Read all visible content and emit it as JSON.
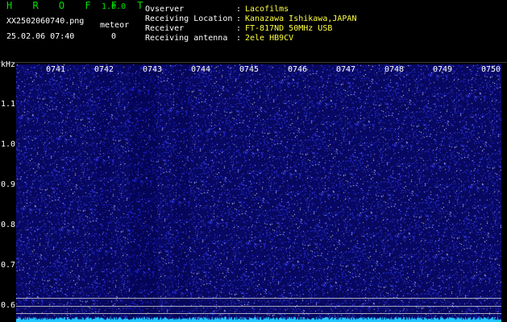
{
  "header": {
    "app_title": "H R O F F T",
    "app_version": "1.0.0",
    "file_name": "XX2502060740.png",
    "timestamp": "25.02.06 07:40",
    "meteor_label": "meteor",
    "meteor_count": "0"
  },
  "info": [
    {
      "label": "Ovserver",
      "colon": ":",
      "value": "Lacofilms"
    },
    {
      "label": "Receiving Location",
      "colon": ":",
      "value": "Kanazawa Ishikawa,JAPAN"
    },
    {
      "label": "Receiver",
      "colon": ":",
      "value": "FT-817ND 50MHz USB"
    },
    {
      "label": "Receiving antenna",
      "colon": ":",
      "value": "2ele HB9CV"
    }
  ],
  "spectrogram": {
    "freq_unit": "kHz",
    "time_labels": [
      "0741",
      "0742",
      "0743",
      "0744",
      "0745",
      "0746",
      "0747",
      "0748",
      "0749",
      "0750"
    ],
    "freq_labels": [
      "1.1",
      "1.0",
      "0.9",
      "0.8",
      "0.7",
      "0.6"
    ],
    "colors": {
      "background": "#0a0a5a",
      "noise": "#3a46ff",
      "baseline": "#20c8ff"
    }
  }
}
